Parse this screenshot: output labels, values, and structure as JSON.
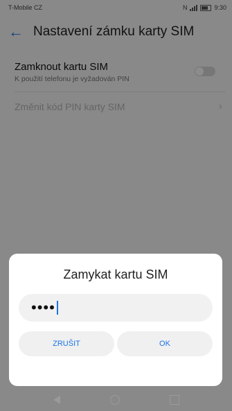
{
  "status": {
    "carrier": "T-Mobile CZ",
    "time": "9:30"
  },
  "appbar": {
    "title": "Nastavení zámku karty SIM"
  },
  "settings": {
    "lock_sim": {
      "title": "Zamknout kartu SIM",
      "subtitle": "K použití telefonu je vyžadován PIN"
    },
    "change_pin": {
      "label": "Změnit kód PIN karty SIM"
    }
  },
  "dialog": {
    "title": "Zamykat kartu SIM",
    "pin_value": "••••",
    "cancel_label": "ZRUŠIT",
    "ok_label": "OK"
  },
  "colors": {
    "accent": "#1a73e8"
  },
  "icons": {
    "back": "arrow-left-icon",
    "chevron": "chevron-right-icon"
  }
}
